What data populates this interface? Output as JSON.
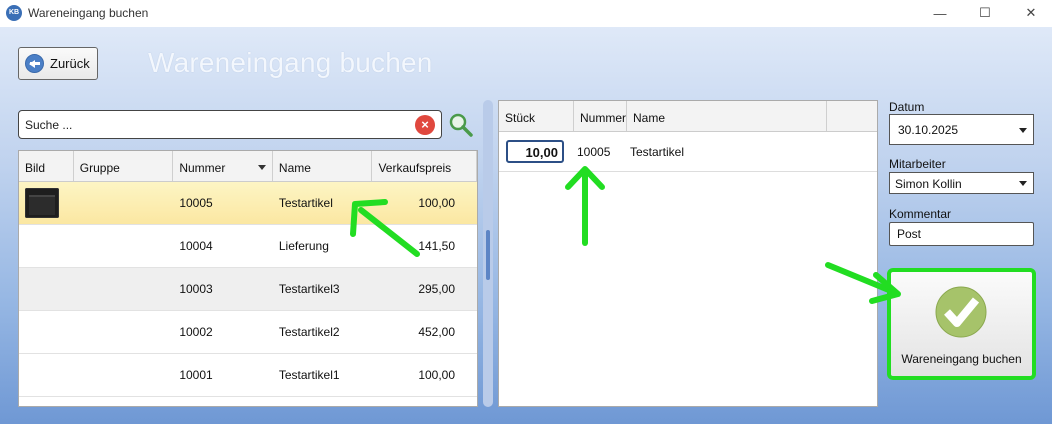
{
  "window": {
    "app_icon_text": "KB",
    "title": "Wareneingang buchen",
    "minimize": "—",
    "maximize": "☐",
    "close": "✕"
  },
  "header": {
    "back_label": "Zurück",
    "page_title": "Wareneingang buchen"
  },
  "search": {
    "placeholder": "Suche ...",
    "clear_symbol": "×"
  },
  "left_grid": {
    "columns": [
      "Bild",
      "Gruppe",
      "Nummer",
      "Name",
      "Verkaufspreis"
    ],
    "rows": [
      {
        "gruppe": "",
        "nummer": "10005",
        "name": "Testartikel",
        "preis": "100,00",
        "selected": true,
        "has_image": true
      },
      {
        "gruppe": "",
        "nummer": "10004",
        "name": "Lieferung",
        "preis": "141,50"
      },
      {
        "gruppe": "",
        "nummer": "10003",
        "name": "Testartikel3",
        "preis": "295,00"
      },
      {
        "gruppe": "",
        "nummer": "10002",
        "name": "Testartikel2",
        "preis": "452,00"
      },
      {
        "gruppe": "",
        "nummer": "10001",
        "name": "Testartikel1",
        "preis": "100,00"
      }
    ]
  },
  "right_grid": {
    "columns": [
      "Stück",
      "Nummer",
      "Name"
    ],
    "rows": [
      {
        "stueck": "10,00",
        "nummer": "10005",
        "name": "Testartikel"
      }
    ]
  },
  "form": {
    "datum_label": "Datum",
    "datum_value": "30.10.2025",
    "mitarbeiter_label": "Mitarbeiter",
    "mitarbeiter_value": "Simon Kollin",
    "kommentar_label": "Kommentar",
    "kommentar_value": "Post"
  },
  "book_button": {
    "label": "Wareneingang buchen"
  },
  "colors": {
    "annotation_arrow": "#22dd22",
    "selection_row": "#fbe9a8",
    "check_icon": "#8db04a"
  }
}
